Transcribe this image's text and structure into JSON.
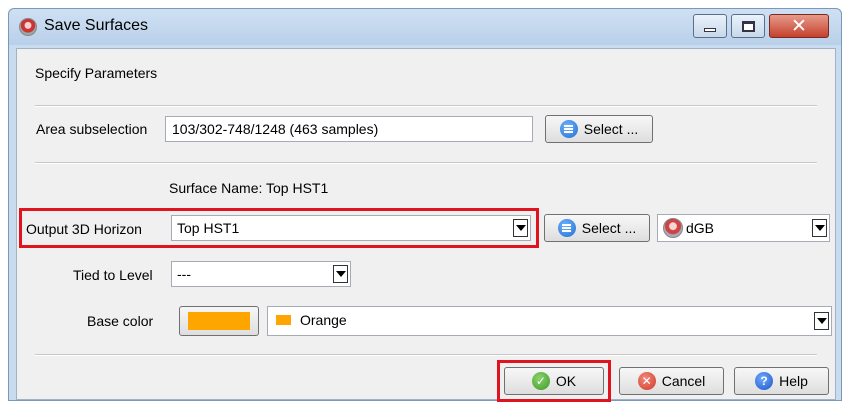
{
  "window": {
    "title": "Save Surfaces",
    "controls": {
      "minimize": "minimize",
      "maximize": "maximize",
      "close": "✕"
    }
  },
  "section_title": "Specify Parameters",
  "area": {
    "label": "Area subselection",
    "value": "103/302-748/1248 (463 samples)",
    "button": "Select ..."
  },
  "surface_name": "Surface Name: Top HST1",
  "output": {
    "label": "Output 3D Horizon",
    "value": "Top HST1",
    "button": "Select ...",
    "format_value": "dGB"
  },
  "tied": {
    "label": "Tied to Level",
    "value": "---"
  },
  "base_color": {
    "label": "Base color",
    "value": "Orange",
    "color": "#ffa500"
  },
  "buttons": {
    "ok": "OK",
    "cancel": "Cancel",
    "help": "Help"
  },
  "highlight_color": "#e0141e"
}
